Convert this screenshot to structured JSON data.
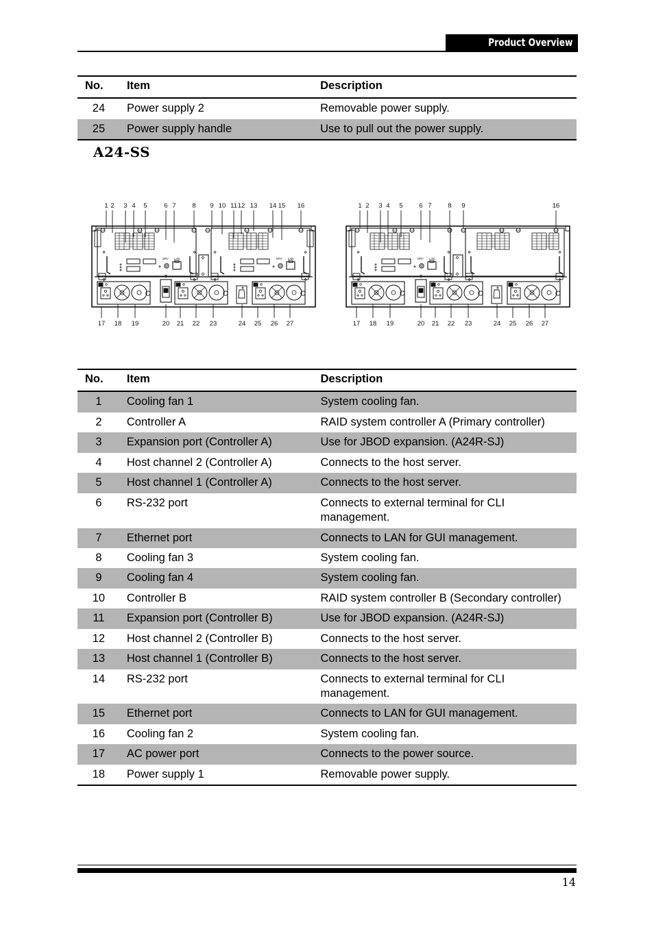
{
  "header": {
    "tab_label": "Product Overview"
  },
  "top_table": {
    "columns": [
      "No.",
      "Item",
      "Description"
    ],
    "rows": [
      {
        "no": "24",
        "item": "Power supply 2",
        "desc": "Removable power supply.",
        "shaded": false
      },
      {
        "no": "25",
        "item": "Power supply handle",
        "desc": "Use to pull out the power supply.",
        "shaded": true
      }
    ]
  },
  "section": {
    "title": "A24-SS"
  },
  "diagrams": {
    "left": {
      "name": "a24-ss-rear-panel-dual-controller",
      "top_callouts": [
        "1",
        "2",
        "3",
        "4",
        "5",
        "6",
        "7",
        "8",
        "9",
        "10",
        "11",
        "12",
        "13",
        "14",
        "15",
        "16"
      ],
      "bottom_callouts": [
        "17",
        "18",
        "19",
        "20",
        "21",
        "22",
        "23",
        "24",
        "25",
        "26",
        "27"
      ],
      "port_labels": [
        "DRV",
        "LAN"
      ]
    },
    "right": {
      "name": "a24-ss-rear-panel-single-controller",
      "top_callouts": [
        "1",
        "2",
        "3",
        "4",
        "5",
        "6",
        "7",
        "8",
        "9",
        "16"
      ],
      "bottom_callouts": [
        "17",
        "18",
        "19",
        "20",
        "21",
        "22",
        "23",
        "24",
        "25",
        "26",
        "27"
      ],
      "port_labels": [
        "DRV",
        "LAN"
      ]
    }
  },
  "main_table": {
    "columns": [
      "No.",
      "Item",
      "Description"
    ],
    "rows": [
      {
        "no": "1",
        "item": "Cooling fan 1",
        "desc": "System cooling fan.",
        "shaded": true
      },
      {
        "no": "2",
        "item": "Controller A",
        "desc": "RAID system controller A (Primary controller)",
        "shaded": false
      },
      {
        "no": "3",
        "item": "Expansion port (Controller A)",
        "desc": "Use for JBOD expansion. (A24R-SJ)",
        "shaded": true
      },
      {
        "no": "4",
        "item": "Host channel 2 (Controller A)",
        "desc": "Connects to the host server.",
        "shaded": false
      },
      {
        "no": "5",
        "item": "Host channel 1 (Controller A)",
        "desc": "Connects to the host server.",
        "shaded": true
      },
      {
        "no": "6",
        "item": "RS-232 port",
        "desc": "Connects to external terminal for CLI management.",
        "shaded": false
      },
      {
        "no": "7",
        "item": "Ethernet port",
        "desc": "Connects to LAN for GUI management.",
        "shaded": true
      },
      {
        "no": "8",
        "item": "Cooling fan 3",
        "desc": "System cooling fan.",
        "shaded": false
      },
      {
        "no": "9",
        "item": "Cooling fan 4",
        "desc": "System cooling fan.",
        "shaded": true
      },
      {
        "no": "10",
        "item": "Controller B",
        "desc": "RAID system controller B (Secondary controller)",
        "shaded": false
      },
      {
        "no": "11",
        "item": "Expansion port (Controller B)",
        "desc": "Use for JBOD expansion. (A24R-SJ)",
        "shaded": true
      },
      {
        "no": "12",
        "item": "Host channel 2 (Controller B)",
        "desc": "Connects to the host server.",
        "shaded": false
      },
      {
        "no": "13",
        "item": "Host channel 1 (Controller B)",
        "desc": "Connects to the host server.",
        "shaded": true
      },
      {
        "no": "14",
        "item": "RS-232 port",
        "desc": "Connects to external terminal for CLI management.",
        "shaded": false
      },
      {
        "no": "15",
        "item": "Ethernet port",
        "desc": "Connects to LAN for GUI management.",
        "shaded": true
      },
      {
        "no": "16",
        "item": "Cooling fan 2",
        "desc": "System cooling fan.",
        "shaded": false
      },
      {
        "no": "17",
        "item": "AC power port",
        "desc": "Connects to the power source.",
        "shaded": true
      },
      {
        "no": "18",
        "item": "Power supply 1",
        "desc": "Removable power supply.",
        "shaded": false
      }
    ]
  },
  "footer": {
    "page_number": "14"
  }
}
